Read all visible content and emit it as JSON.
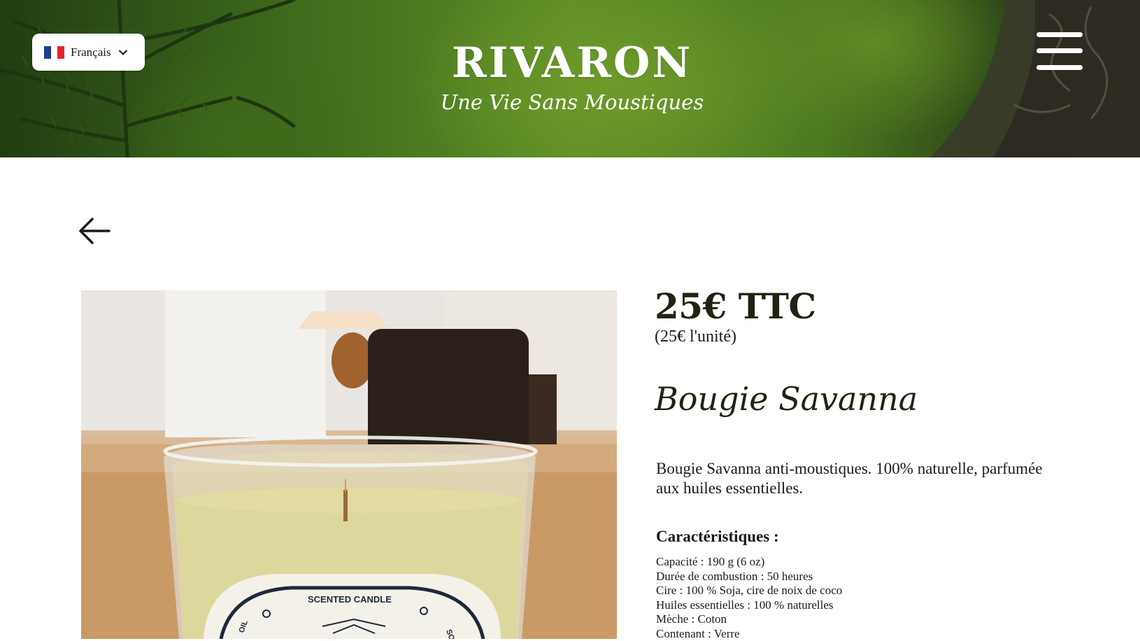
{
  "header": {
    "language": {
      "label": "Français",
      "flag_colors": [
        "#1a3f95",
        "#ffffff",
        "#e0262d"
      ]
    },
    "brand_name": "RIVARON",
    "tagline": "Une Vie Sans Moustiques",
    "colors": {
      "banner_green": "#4d7a20",
      "brand_text": "#ffffff"
    }
  },
  "nav": {
    "back_icon": "arrow-left-icon",
    "menu_icon": "hamburger-menu-icon"
  },
  "product": {
    "price": "25€ TTC",
    "unit_price": "(25€ l'unité)",
    "title": "Bougie Savanna",
    "description": "Bougie Savanna anti-moustiques. 100% naturelle, parfumée aux huiles essentielles.",
    "specs_heading": "Caractéristiques :",
    "specs": [
      "Capacité : 190 g (6 oz)",
      "Durée de combustion : 50 heures",
      "Cire : 100 % Soja, cire de noix de coco",
      "Huiles essentielles : 100 % naturelles",
      "Mèche : Coton",
      "Contenant : Verre"
    ],
    "image_label": {
      "top": "SCENTED CANDLE",
      "left": "OIL",
      "right": "SOY"
    }
  }
}
